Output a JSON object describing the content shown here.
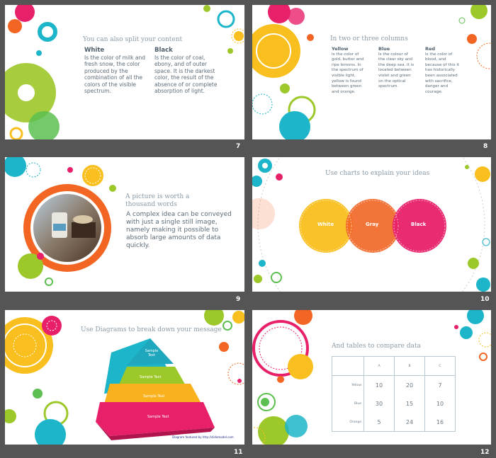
{
  "slides": [
    {
      "number": "7",
      "title": "You can also split your content",
      "columns": [
        {
          "heading": "White",
          "body": "Is the color of milk and fresh snow, the color produced by the combination of all the colors of the visible spectrum."
        },
        {
          "heading": "Black",
          "body": "Is the color of coal, ebony, and of outer space. It is the darkest color, the result of the absence of or complete absorption of light."
        }
      ]
    },
    {
      "number": "8",
      "title": "In two or three columns",
      "columns": [
        {
          "heading": "Yellow",
          "body": "Is the color of gold, butter and ripe lemons. In the spectrum of visible light, yellow is found between green and orange."
        },
        {
          "heading": "Blue",
          "body": "Is the colour of the clear sky and the deep sea. It is located between violet and green on the optical spectrum."
        },
        {
          "heading": "Red",
          "body": "Is the color of blood, and because of this it has historically been associated with sacrifice, danger and courage."
        }
      ]
    },
    {
      "number": "9",
      "title": "A picture is worth a thousand words",
      "body": "A complex idea can be conveyed with just a single still image, namely making it possible to absorb large amounts of data quickly."
    },
    {
      "number": "10",
      "title": "Use charts to explain your ideas",
      "circles": [
        "White",
        "Gray",
        "Black"
      ]
    },
    {
      "number": "11",
      "title": "Use Diagrams to break down your message",
      "pyramid": [
        "Sample Text",
        "Sample Text",
        "Sample Text",
        "Sample Text"
      ],
      "credit": "Diagram featured by http://slidemodel.com"
    },
    {
      "number": "12",
      "title": "And tables to compare data",
      "table": {
        "columns": [
          "A",
          "B",
          "C"
        ],
        "rows": [
          {
            "label": "Yellow",
            "values": [
              "10",
              "20",
              "7"
            ]
          },
          {
            "label": "Blue",
            "values": [
              "30",
              "15",
              "10"
            ]
          },
          {
            "label": "Orange",
            "values": [
              "5",
              "24",
              "16"
            ]
          }
        ]
      }
    }
  ],
  "colors": {
    "yellow": "#f9bf1e",
    "teal": "#1cb5c9",
    "pink": "#e8206a",
    "orange": "#f26522",
    "green": "#9dc82a",
    "background": "#555555"
  }
}
